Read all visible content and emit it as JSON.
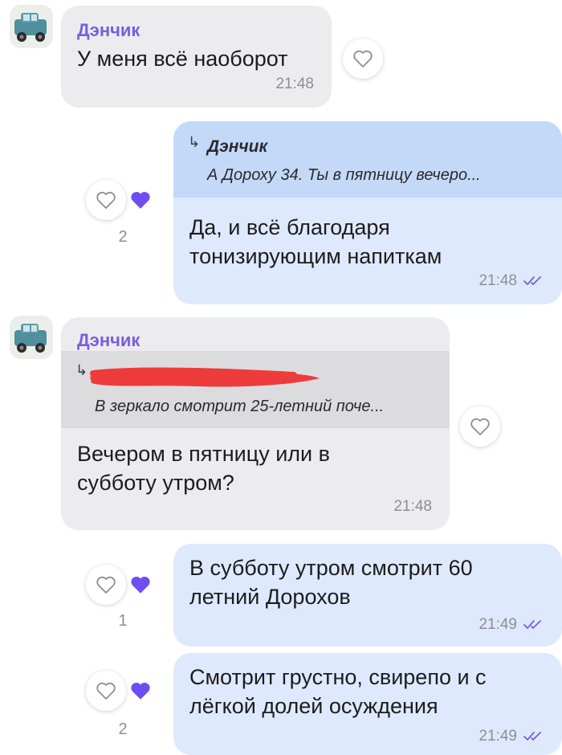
{
  "colors": {
    "sender_name": "#7b5de0",
    "incoming_bubble": "#ececee",
    "outgoing_bubble": "#dfe9fd",
    "outgoing_quote": "#c4d9f8",
    "incoming_quote": "#dcdcde",
    "heart_filled": "#6e4ef2",
    "time_text": "#8e8e93",
    "redaction": "#ee3b3b"
  },
  "messages": [
    {
      "direction": "incoming",
      "sender": "Дэнчик",
      "text": "У меня всё наоборот",
      "time": "21:48",
      "icons": [
        "car-avatar",
        "heart-outline-icon"
      ]
    },
    {
      "direction": "outgoing",
      "quote": {
        "name": "Дэнчик",
        "text": "А Дороху 34. Ты в пятницу вечеро..."
      },
      "text_lines": [
        "Да, и всё благодаря",
        "тонизирующим напиткам"
      ],
      "time": "21:48",
      "like_count": "2",
      "icons": [
        "heart-outline-icon",
        "heart-filled-icon",
        "double-check-icon"
      ]
    },
    {
      "direction": "incoming",
      "sender": "Дэнчик",
      "quote": {
        "text": "В зеркало смотрит 25-летний поче..."
      },
      "text_lines": [
        "Вечером в пятницу или в",
        "субботу утром?"
      ],
      "time": "21:48",
      "icons": [
        "car-avatar",
        "heart-outline-icon",
        "redaction-scribble"
      ]
    },
    {
      "direction": "outgoing",
      "text_lines": [
        "В субботу утром смотрит 60",
        "летний Дорохов"
      ],
      "time": "21:49",
      "like_count": "1",
      "icons": [
        "heart-outline-icon",
        "heart-filled-icon",
        "double-check-icon"
      ]
    },
    {
      "direction": "outgoing",
      "text_lines": [
        "Смотрит грустно, свирепо и с",
        "лёгкой долей осуждения"
      ],
      "time": "21:49",
      "like_count": "2",
      "icons": [
        "heart-outline-icon",
        "heart-filled-icon",
        "double-check-icon"
      ]
    }
  ]
}
